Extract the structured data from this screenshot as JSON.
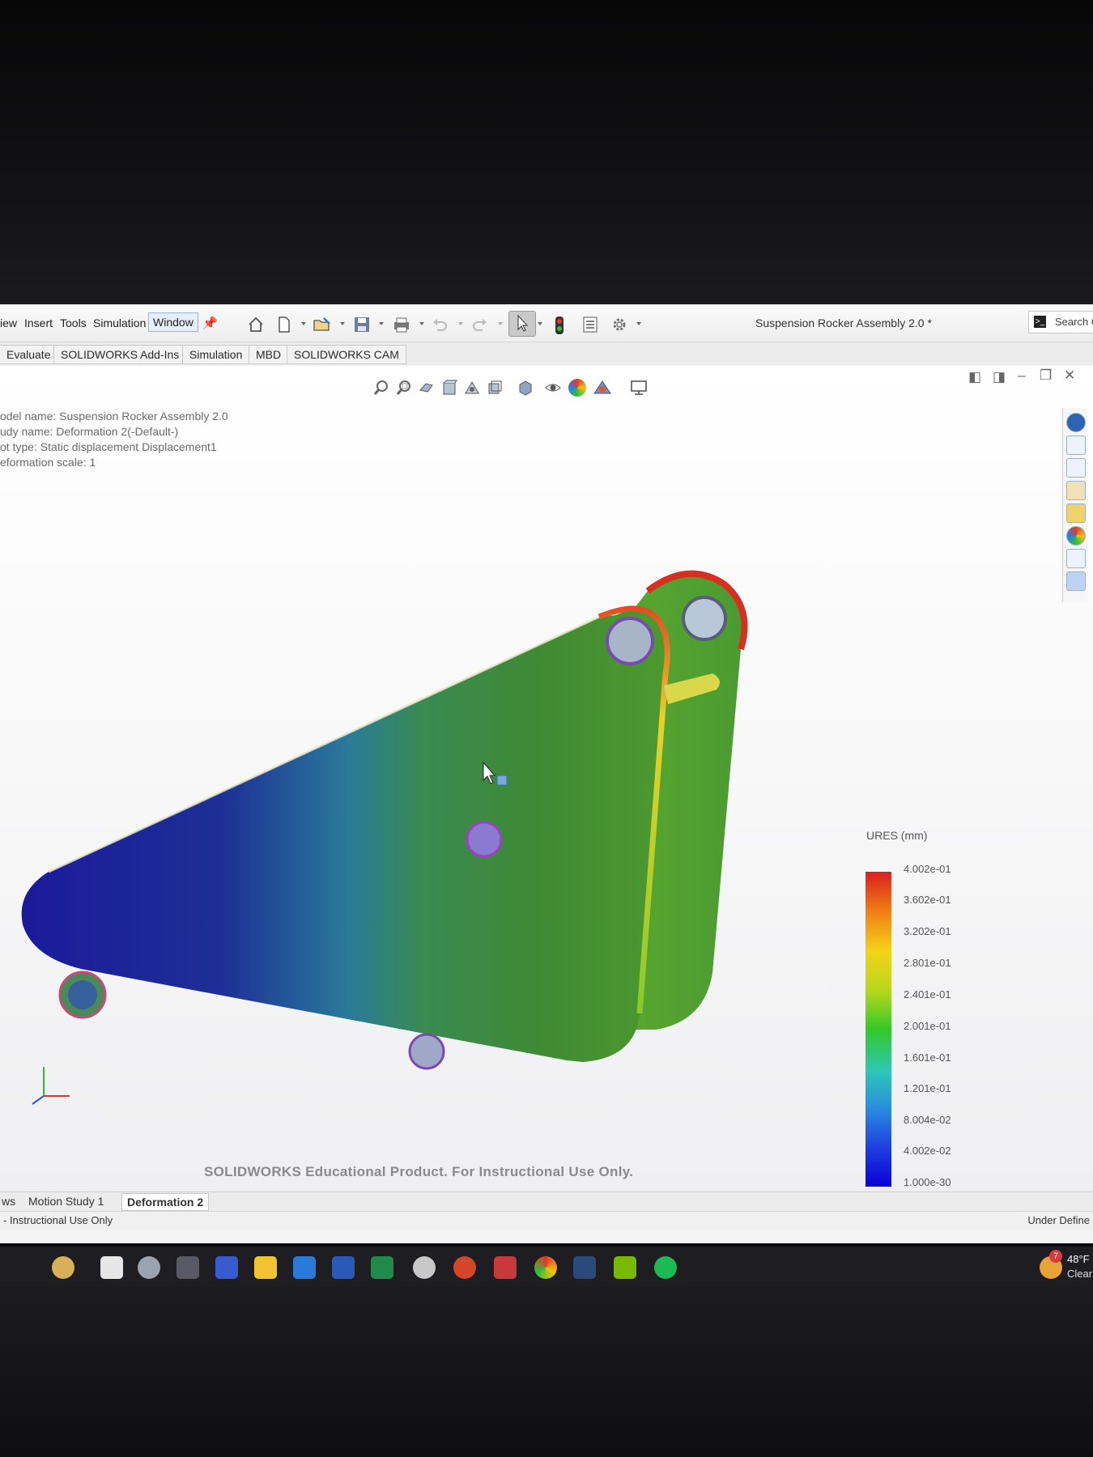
{
  "window": {
    "title": "Suspension Rocker Assembly 2.0 *"
  },
  "menu": {
    "items": [
      "iew",
      "Insert",
      "Tools",
      "Simulation",
      "Window"
    ]
  },
  "search": {
    "label": "Search C"
  },
  "command_tabs": [
    "Evaluate",
    "SOLIDWORKS Add-Ins",
    "Simulation",
    "MBD",
    "SOLIDWORKS CAM"
  ],
  "study_info": {
    "model_name": "odel name: Suspension Rocker Assembly 2.0",
    "study_name": "udy name: Deformation 2(-Default-)",
    "plot_type": "ot type: Static displacement Displacement1",
    "deformation_scale": "eformation scale: 1"
  },
  "legend": {
    "title": "URES (mm)",
    "labels": [
      "4.002e-01",
      "3.602e-01",
      "3.202e-01",
      "2.801e-01",
      "2.401e-01",
      "2.001e-01",
      "1.601e-01",
      "1.201e-01",
      "8.004e-02",
      "4.002e-02",
      "1.000e-30"
    ],
    "colors": [
      "#d82020",
      "#f07a14",
      "#f4d318",
      "#b4d81c",
      "#34c82a",
      "#2ec8b4",
      "#2a8ee0",
      "#1e3ce0",
      "#0a00d8"
    ]
  },
  "watermark": "SOLIDWORKS Educational Product. For Instructional Use Only.",
  "bottom_tabs": [
    "ws",
    "Motion Study 1",
    "Deformation 2"
  ],
  "status": {
    "left": "- Instructional Use Only",
    "right": "Under Define"
  },
  "taskbar": {
    "icons": [
      "copilot-icon",
      "task-view-icon",
      "settings-icon",
      "solidworks-icon",
      "matlab-icon",
      "file-explorer-icon",
      "outlook-icon",
      "word-icon",
      "excel-icon",
      "chatgpt-icon",
      "powerpoint-icon",
      "solidworks-app-icon",
      "chrome-icon",
      "steam-icon",
      "nvidia-icon",
      "spotify-icon"
    ],
    "weather_temp": "48°F",
    "weather_cond": "Clear",
    "notification_count": "7"
  }
}
